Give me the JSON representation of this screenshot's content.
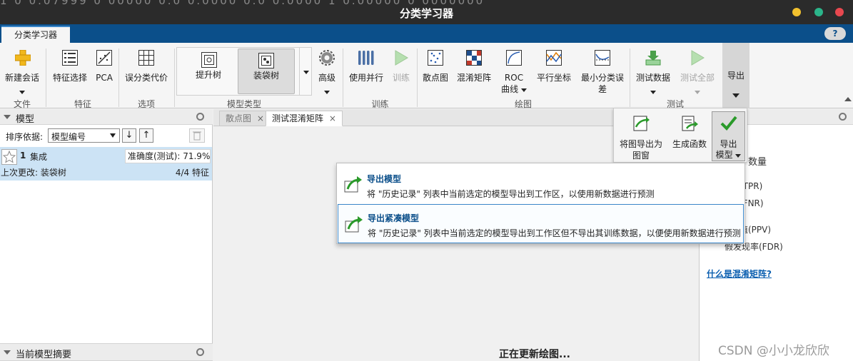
{
  "window": {
    "title": "分类学习器",
    "background_text": "1 0 0.07999 0 00000  0.0 0.0000  0.0 0.0000  1 0.00000  0 0000000"
  },
  "app_tab": {
    "label": "分类学习器"
  },
  "help": {
    "label": "?"
  },
  "ribbon": {
    "new_session": "新建会话",
    "feature_selection": "特征选择",
    "pca": "PCA",
    "misclass_cost": "误分类代价",
    "boosted_trees": "提升树",
    "bagged_trees": "装袋树",
    "advanced": "高级",
    "use_parallel": "使用并行",
    "train": "训练",
    "scatter": "散点图",
    "confusion_matrix": "混淆矩阵",
    "roc_line1": "ROC",
    "roc_line2": "曲线",
    "parallel_coords": "平行坐标",
    "min_cost_line1": "最小分类误",
    "min_cost_line2": "差",
    "test_data": "测试数据",
    "test_all": "测试全部",
    "export": "导出",
    "groups": {
      "file": "文件",
      "features": "特征",
      "options": "选项",
      "model_type": "模型类型",
      "training": "训练",
      "plots": "绘图",
      "test": "测试"
    }
  },
  "export_panel": {
    "export_plot_line1": "将图导出为",
    "export_plot_line2": "图窗",
    "generate_function": "生成函数",
    "export_model_line1": "导出",
    "export_model_line2": "模型"
  },
  "export_menu": {
    "items": [
      {
        "title": "导出模型",
        "desc": "将 \"历史记录\" 列表中当前选定的模型导出到工作区，以使用新数据进行预测"
      },
      {
        "title": "导出紧凑模型",
        "desc": "将 \"历史记录\" 列表中当前选定的模型导出到工作区但不导出其训练数据，以便使用新数据进行预测"
      }
    ]
  },
  "models_panel": {
    "title": "模型",
    "sort_label": "排序依据:",
    "sort_value": "模型编号",
    "model": {
      "number": "1",
      "name": "集成",
      "accuracy": "准确度(测试): 71.9%",
      "last_change": "上次更改: 装袋树",
      "features": "4/4 特征"
    }
  },
  "summary_panel": {
    "title": "当前模型摘要"
  },
  "doc_tabs": [
    {
      "label": "散点图"
    },
    {
      "label": "测试混淆矩阵"
    }
  ],
  "doc_status": "正在更新绘图...",
  "right_panel": {
    "count": "数量",
    "tpr": "率(TPR)",
    "fnr": "率(FNR)",
    "ppv": "测值(PPV)",
    "fdr": "假发现率(FDR)",
    "link": "什么是混淆矩阵?"
  },
  "watermark": "CSDN @小小龙欣欣",
  "colors": {
    "title_bar": "#2b2b2b",
    "tab_strip": "#0b4f8a",
    "selected_row": "#cce3f5",
    "link": "#0b5fb0",
    "minimize": "#f2c12e",
    "maximize": "#2bb58a",
    "close": "#e8484f"
  }
}
